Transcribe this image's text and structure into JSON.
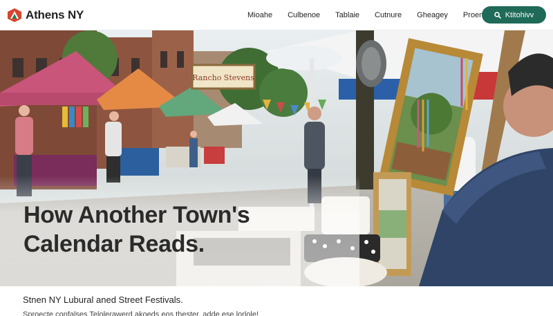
{
  "brand": {
    "name": "Athens NY"
  },
  "nav": {
    "items": [
      "Mioahe",
      "Culbenoe",
      "Tablaie",
      "Cutnure",
      "Gheagey",
      "Proende"
    ]
  },
  "cta": {
    "label": "Ktitohivv",
    "icon": "search-icon"
  },
  "hero": {
    "headline_line1": "How Another Town's",
    "headline_line2": "Calendar Reads.",
    "sign_text": "Rancho Stevens"
  },
  "article": {
    "subhead": "Stnen NY Lubural aned Street Festivals.",
    "description": "Sproecte confalses Telolerawerd akoeds eos thester, adde ese lorlole!"
  },
  "colors": {
    "accent": "#1f6a58",
    "logo_red": "#d9452f",
    "logo_green": "#2d7a5a"
  }
}
